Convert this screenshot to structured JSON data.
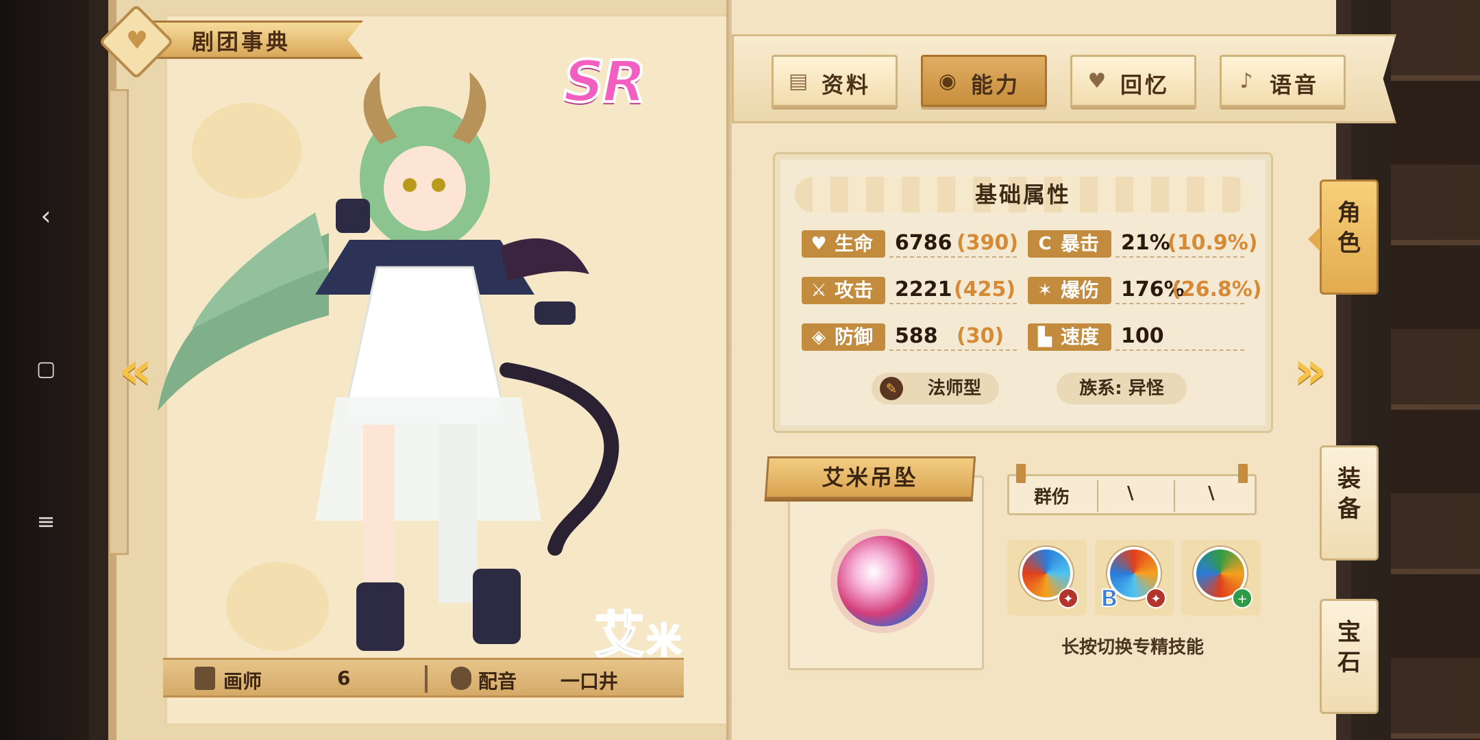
{
  "header": {
    "title": "剧团事典"
  },
  "rarity": "SR",
  "character": {
    "name_big": "艾",
    "name_small": "米"
  },
  "credits": {
    "artist_label": "画师",
    "artist_value": "6",
    "voice_label": "配音",
    "voice_value": "一口井"
  },
  "tabs": [
    {
      "label": "资料",
      "icon": "notebook-icon",
      "active": false
    },
    {
      "label": "能力",
      "icon": "skill-icon",
      "active": true
    },
    {
      "label": "回忆",
      "icon": "heart-icon",
      "active": false
    },
    {
      "label": "语音",
      "icon": "microphone-icon",
      "active": false
    }
  ],
  "stats": {
    "title": "基础属性",
    "rows": [
      {
        "label": "生命",
        "icon": "heart-icon",
        "value": "6786",
        "bonus": "(390)"
      },
      {
        "label": "暴击",
        "icon": "crit-icon",
        "value": "21%",
        "bonus": "(10.9%)"
      },
      {
        "label": "攻击",
        "icon": "sword-icon",
        "value": "2221",
        "bonus": "(425)"
      },
      {
        "label": "爆伤",
        "icon": "burst-icon",
        "value": "176%",
        "bonus": "(26.8%)"
      },
      {
        "label": "防御",
        "icon": "shield-icon",
        "value": "588",
        "bonus": "(30)"
      },
      {
        "label": "速度",
        "icon": "boot-icon",
        "value": "100",
        "bonus": ""
      }
    ],
    "type_label": "法师型",
    "race_label": "族系: 异怪"
  },
  "item": {
    "title": "艾米吊坠"
  },
  "skills": {
    "header": [
      "群伤",
      "\\",
      "\\"
    ],
    "hint": "长按切换专精技能"
  },
  "side_tabs": [
    {
      "label": "角色",
      "active": true
    },
    {
      "label": "装备",
      "active": false
    },
    {
      "label": "宝石",
      "active": false
    }
  ],
  "colors": {
    "accent": "#c38b3d",
    "bonus": "#d68a36",
    "rarity": "#f35fc0"
  }
}
